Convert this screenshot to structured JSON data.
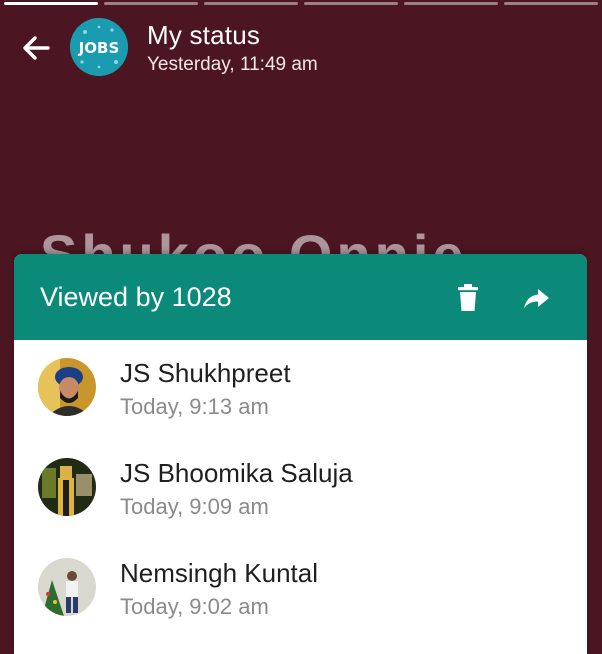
{
  "status": {
    "title": "My status",
    "time": "Yesterday, 11:49 am",
    "avatar_text": "JOBS",
    "bg_text": "Shukoo Onnie"
  },
  "progress": {
    "segments": 6,
    "active_index": 0,
    "fraction_viewed": 0.35
  },
  "viewers_panel": {
    "title": "Viewed by 1028",
    "delete_icon": "trash-icon",
    "forward_icon": "forward-arrow-icon",
    "viewers": [
      {
        "name": "JS Shukhpreet",
        "time": "Today, 9:13 am"
      },
      {
        "name": "JS Bhoomika Saluja",
        "time": "Today, 9:09 am"
      },
      {
        "name": "Nemsingh Kuntal",
        "time": "Today, 9:02 am"
      }
    ]
  },
  "colors": {
    "background": "#4b1622",
    "header": "#0b8a79",
    "avatar": "#1b9bb0",
    "name_text": "#1f1f1f",
    "time_text": "#8a8a8a"
  }
}
